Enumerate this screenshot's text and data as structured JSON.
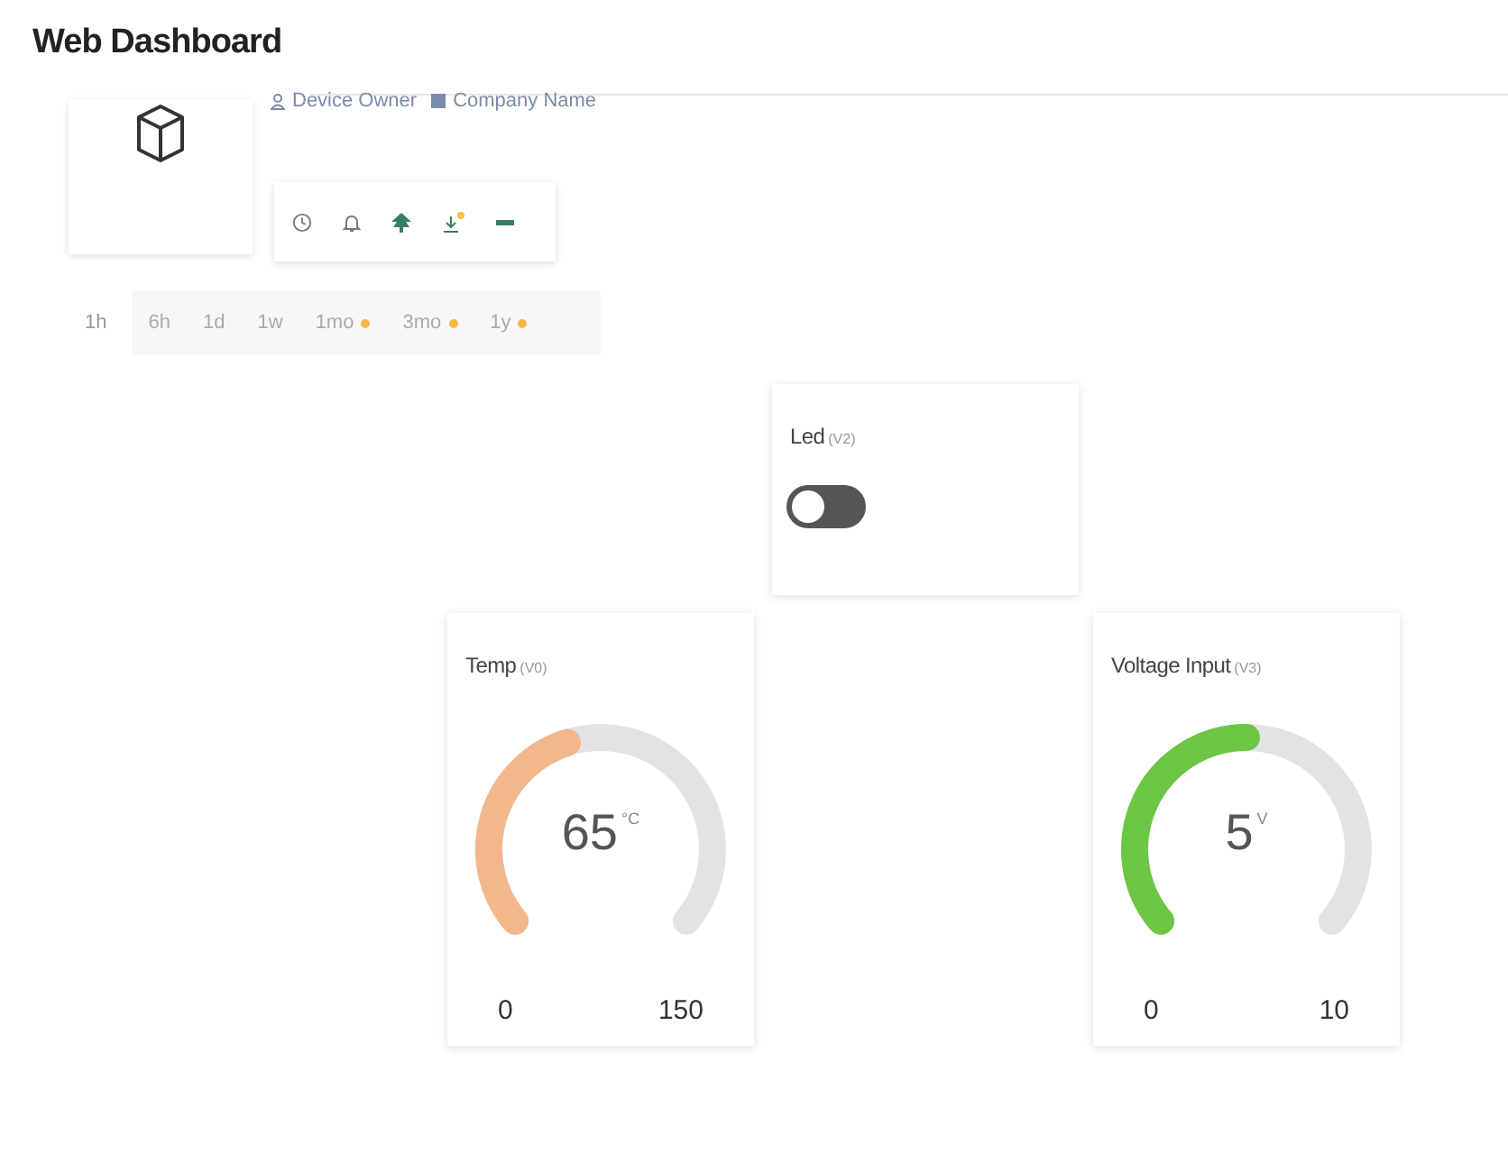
{
  "page": {
    "title": "Web Dashboard"
  },
  "device": {
    "owner": "Device Owner",
    "company": "Company Name"
  },
  "time_ranges": [
    {
      "label": "1h",
      "selected": true,
      "premium": false
    },
    {
      "label": "6h",
      "selected": false,
      "premium": false
    },
    {
      "label": "1d",
      "selected": false,
      "premium": false
    },
    {
      "label": "1w",
      "selected": false,
      "premium": false
    },
    {
      "label": "1mo",
      "selected": false,
      "premium": true
    },
    {
      "label": "3mo",
      "selected": false,
      "premium": true
    },
    {
      "label": "1y",
      "selected": false,
      "premium": true
    }
  ],
  "widgets": [
    {
      "kind": "switch",
      "title": "Led",
      "pin": "(V2)",
      "on": false
    },
    {
      "kind": "gauge",
      "title": "Temp",
      "pin": "(V0)",
      "value": "65",
      "unit": "°C",
      "min": "0",
      "max": "150",
      "color": "#f2b78a"
    },
    {
      "kind": "gauge",
      "title": "Voltage Input",
      "pin": "(V3)",
      "value": "5",
      "unit": "V",
      "min": "0",
      "max": "10",
      "color": "#6cc644"
    }
  ]
}
